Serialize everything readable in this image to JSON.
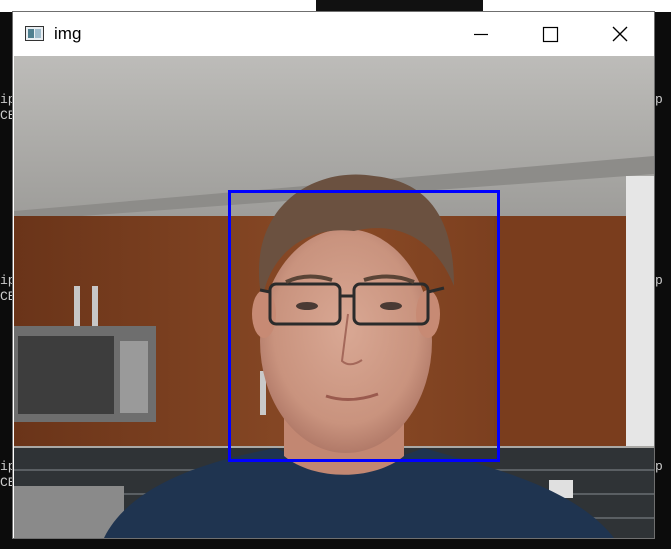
{
  "window": {
    "title": "img",
    "controls": {
      "minimize": "minimize",
      "maximize": "maximize",
      "close": "close"
    }
  },
  "terminal": {
    "left_lines": [
      "ip",
      "CE",
      "",
      "",
      "",
      "",
      "",
      "",
      "",
      "",
      "",
      "",
      "",
      "",
      "",
      "ip",
      "CE",
      "",
      "",
      "",
      "",
      "",
      "",
      "",
      "",
      "",
      "",
      "",
      "",
      "",
      "",
      "ip",
      "CE"
    ],
    "right_lines": [
      "p",
      "",
      "",
      "",
      "",
      "",
      "",
      "",
      "",
      "",
      "",
      "",
      "",
      "",
      "",
      "p",
      "",
      "",
      "",
      "",
      "",
      "",
      "",
      "",
      "",
      "",
      "",
      "",
      "",
      "",
      "",
      "p",
      ""
    ]
  },
  "image": {
    "description_icon": "camera-frame",
    "face_box_color": "#0000ff"
  }
}
